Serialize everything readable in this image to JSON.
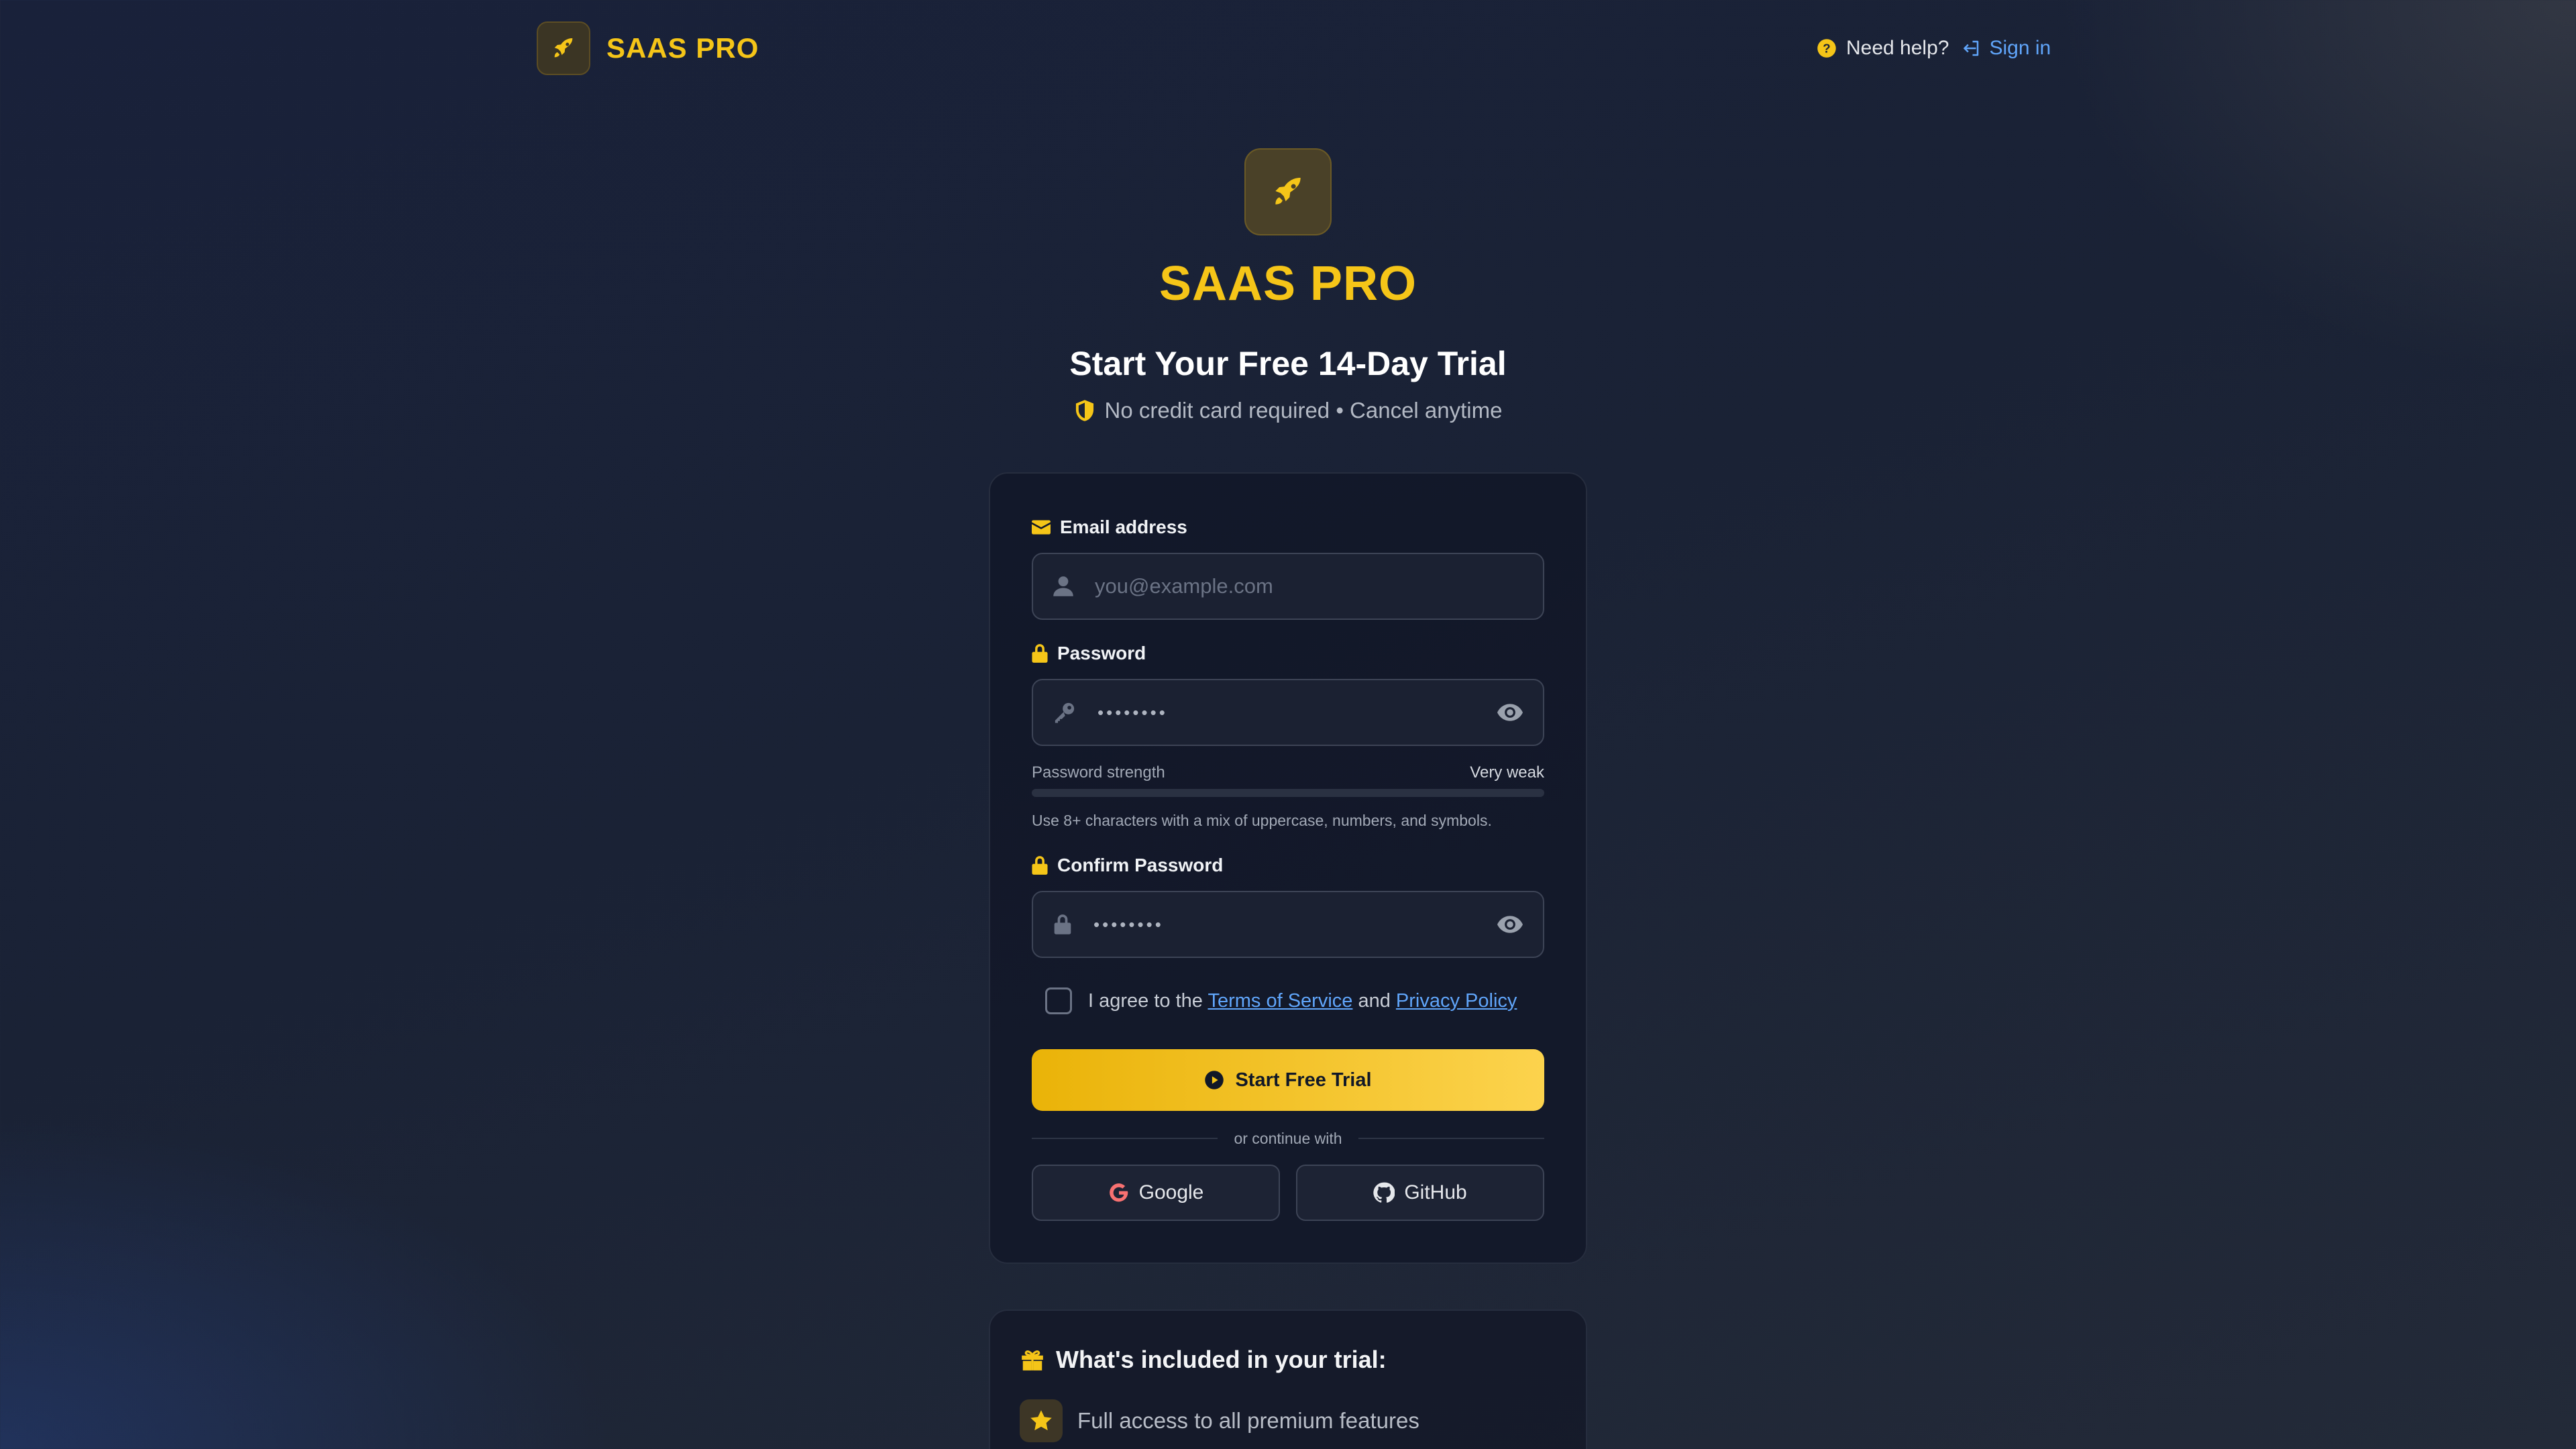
{
  "header": {
    "brand_name": "SAAS PRO",
    "help_label": "Need help?",
    "signin_label": "Sign in"
  },
  "hero": {
    "title": "SAAS PRO",
    "subtitle": "Start Your Free 14-Day Trial",
    "note": "No credit card required • Cancel anytime"
  },
  "form": {
    "email": {
      "label": "Email address",
      "placeholder": "you@example.com"
    },
    "password": {
      "label": "Password",
      "value_masked": "••••••••"
    },
    "strength": {
      "label": "Password strength",
      "level": "Very weak",
      "fraction": 0.0
    },
    "hint": "Use 8+ characters with a mix of uppercase, numbers, and symbols.",
    "confirm": {
      "label": "Confirm Password",
      "value_masked": "••••••••"
    },
    "agree": {
      "prefix": "I agree to the",
      "terms": "Terms of Service",
      "and": "and",
      "privacy": "Privacy Policy",
      "checked": false
    },
    "submit_label": "Start Free Trial",
    "divider_text": "or continue with",
    "google_label": "Google",
    "github_label": "GitHub"
  },
  "included": {
    "title": "What's included in your trial:",
    "items": [
      "Full access to all premium features"
    ]
  },
  "colors": {
    "accent": "#f5c518",
    "link": "#60a5fa",
    "background": "#1a2235"
  }
}
